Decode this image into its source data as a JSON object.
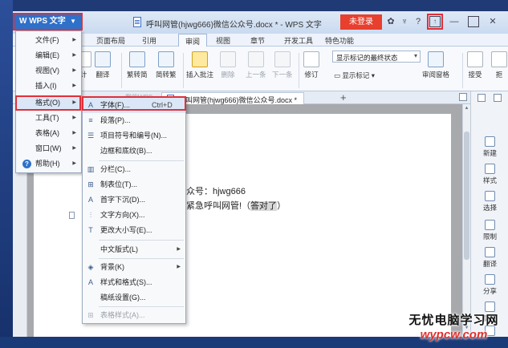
{
  "window": {
    "title": "呼叫网管(hjwg666)微信公众号.docx * - WPS 文字",
    "login_label": "未登录",
    "title_icons": [
      "settings-icon",
      "shirt-icon",
      "help-icon",
      "minimize-icon",
      "maximize-icon",
      "close-icon"
    ]
  },
  "wps_menu": {
    "label": "WPS 文字",
    "items": [
      {
        "label": "文件(F)",
        "submenu": true
      },
      {
        "label": "编辑(E)",
        "submenu": true
      },
      {
        "label": "视图(V)",
        "submenu": true
      },
      {
        "label": "插入(I)",
        "submenu": true
      },
      {
        "label": "格式(O)",
        "submenu": true,
        "active": true
      },
      {
        "label": "工具(T)",
        "submenu": true
      },
      {
        "label": "表格(A)",
        "submenu": true
      },
      {
        "label": "窗口(W)",
        "submenu": true
      },
      {
        "label": "帮助(H)",
        "submenu": true
      }
    ]
  },
  "ribbon_tabs": [
    "页面布局",
    "引用",
    "审阅",
    "视图",
    "章节",
    "开发工具",
    "特色功能"
  ],
  "ribbon": {
    "buttons": [
      {
        "label": "计",
        "icon": "text-icon"
      },
      {
        "label": "翻译",
        "icon": "translate-icon"
      },
      {
        "label": "繁转简",
        "icon": "trad-to-simp-icon"
      },
      {
        "label": "简转繁",
        "icon": "simp-to-trad-icon"
      },
      {
        "label": "插入批注",
        "icon": "insert-comment-icon"
      },
      {
        "label": "删除",
        "icon": "delete-comment-icon",
        "disabled": true
      },
      {
        "label": "上一条",
        "icon": "prev-comment-icon",
        "disabled": true
      },
      {
        "label": "下一条",
        "icon": "next-comment-icon",
        "disabled": true
      },
      {
        "label": "修订",
        "icon": "track-changes-icon"
      },
      {
        "label": "审阅窗格",
        "icon": "review-pane-icon"
      },
      {
        "label": "接受",
        "icon": "accept-icon"
      },
      {
        "label": "拒",
        "icon": "reject-icon"
      }
    ],
    "markup_select": "显示标记的最终状态",
    "show_markup": "显示标记"
  },
  "doc_tabs": {
    "faded_label": "我的WPS",
    "active": "呼叫网管(hjwg666)微信公众号.docx *",
    "add_label": "+"
  },
  "document": {
    "line1": "众号：hjwg666",
    "line2_before": "紧急呼叫网管!（",
    "line2_highlight": "答对了",
    "line2_after": "）"
  },
  "format_submenu": [
    {
      "icon": "A",
      "name": "font",
      "label": "字体(F)...",
      "shortcut": "Ctrl+D"
    },
    {
      "icon": "≡",
      "name": "paragraph",
      "label": "段落(P)..."
    },
    {
      "icon": "☰",
      "name": "bullets",
      "label": "项目符号和编号(N)..."
    },
    {
      "icon": "",
      "name": "borders",
      "label": "边框和底纹(B)..."
    },
    {
      "separator": true
    },
    {
      "icon": "▥",
      "name": "columns",
      "label": "分栏(C)..."
    },
    {
      "icon": "⊞",
      "name": "tabs",
      "label": "制表位(T)..."
    },
    {
      "icon": "A",
      "name": "dropcap",
      "label": "首字下沉(D)..."
    },
    {
      "icon": "⫶",
      "name": "text-direction",
      "label": "文字方向(X)..."
    },
    {
      "icon": "T",
      "name": "change-case",
      "label": "更改大小写(E)..."
    },
    {
      "separator": true
    },
    {
      "icon": "",
      "name": "asian-layout",
      "label": "中文版式(L)",
      "submenu": true
    },
    {
      "separator": true
    },
    {
      "icon": "◈",
      "name": "background",
      "label": "背景(K)",
      "submenu": true
    },
    {
      "icon": "A",
      "name": "styles",
      "label": "样式和格式(S)..."
    },
    {
      "icon": "",
      "name": "manuscript",
      "label": "稿纸设置(G)..."
    },
    {
      "separator": true
    },
    {
      "icon": "⊞",
      "name": "table-style",
      "label": "表格样式(A)...",
      "disabled": true
    }
  ],
  "task_pane": [
    {
      "label": "新建",
      "icon": "new-icon"
    },
    {
      "label": "样式",
      "icon": "style-icon"
    },
    {
      "label": "选择",
      "icon": "select-icon"
    },
    {
      "label": "限制",
      "icon": "restrict-icon"
    },
    {
      "label": "翻译",
      "icon": "translate-icon"
    },
    {
      "label": "分享",
      "icon": "share-icon"
    },
    {
      "label": "属性",
      "icon": "properties-icon"
    },
    {
      "label": "反馈",
      "icon": "feedback-icon"
    }
  ],
  "watermark": {
    "line1": "无忧电脑学习网",
    "line2": "wypcw.com"
  }
}
